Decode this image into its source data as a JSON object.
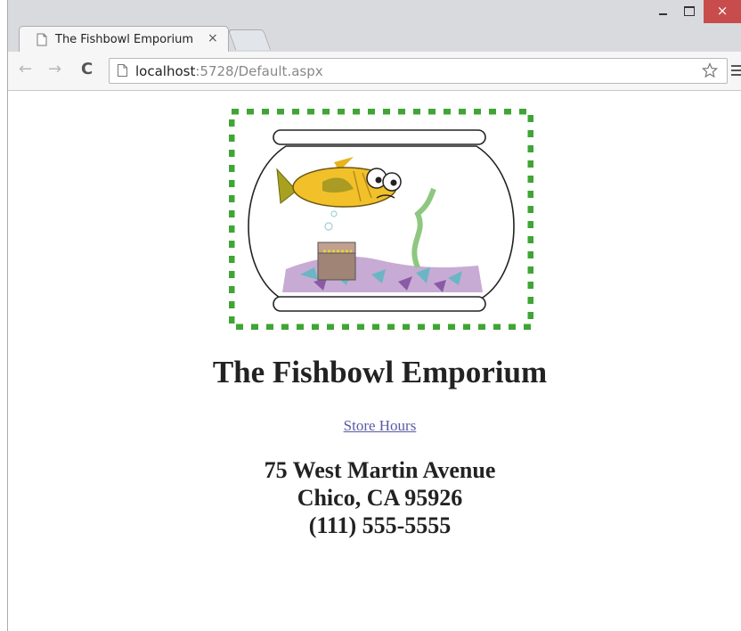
{
  "browser": {
    "tab_title": "The Fishbowl Emporium",
    "tab_close": "×",
    "url_host": "localhost",
    "url_rest": ":5728/Default.aspx",
    "close_glyph": "×",
    "back_glyph": "←",
    "forward_glyph": "→",
    "reload_glyph": "C"
  },
  "page": {
    "heading": "The Fishbowl Emporium",
    "hours_link": "Store Hours",
    "address_line1": "75 West Martin Avenue",
    "address_line2": "Chico, CA 95926",
    "phone": "(111) 555-5555"
  },
  "colors": {
    "link": "#5a5aa6",
    "border_green": "#3fa535",
    "fish_yellow": "#f2c12a",
    "close_red": "#c94c4c"
  },
  "icons": [
    "page-icon",
    "close-icon",
    "minimize-icon",
    "maximize-icon",
    "back-arrow-icon",
    "forward-arrow-icon",
    "reload-icon",
    "star-icon",
    "menu-icon"
  ]
}
